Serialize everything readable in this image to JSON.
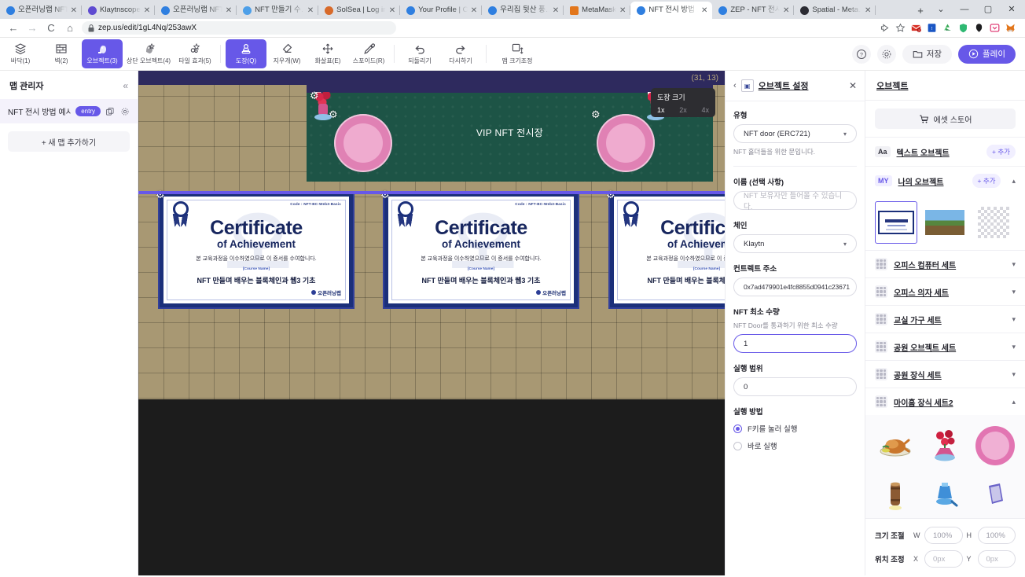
{
  "browser": {
    "tabs": [
      {
        "title": "오픈러닝랩 NFT",
        "favicon": "blue-circle",
        "active": false
      },
      {
        "title": "Klaytnscope",
        "favicon": "klaytn",
        "active": false
      },
      {
        "title": "오픈러닝랩 NFT",
        "favicon": "blue-circle",
        "active": false
      },
      {
        "title": "NFT 만들기 수…",
        "favicon": "paper-plane",
        "active": false
      },
      {
        "title": "SolSea | Log in",
        "favicon": "solsea",
        "active": false
      },
      {
        "title": "Your Profile | O…",
        "favicon": "blue-circle",
        "active": false
      },
      {
        "title": "우리집 뒷산 풍…",
        "favicon": "blue-circle",
        "active": false
      },
      {
        "title": "MetaMask",
        "favicon": "metamask",
        "active": false
      },
      {
        "title": "NFT 전시 방법 …",
        "favicon": "zep",
        "active": true
      },
      {
        "title": "ZEP - NFT 전시…",
        "favicon": "zep",
        "active": false
      },
      {
        "title": "Spatial - Meta…",
        "favicon": "spatial",
        "active": false
      }
    ],
    "new_tab_label": "+",
    "window_controls": [
      "⌄",
      "—",
      "▢",
      "✕"
    ],
    "nav": {
      "back": "←",
      "forward": "→",
      "reload": "C",
      "home": "⌂"
    },
    "url": "zep.us/edit/1gL4Nq/253awX",
    "lock_icon": "lock-icon",
    "actions": [
      "share-icon",
      "bookmark-star-icon"
    ],
    "extensions": [
      "gmail-icon",
      "translate-icon",
      "recycle-icon",
      "shield-icon",
      "ghost-icon",
      "pocket-icon",
      "metamask-icon"
    ]
  },
  "toolbar": {
    "tools": [
      {
        "label": "바닥(1)",
        "icon": "layers-icon",
        "active": false
      },
      {
        "label": "벽(2)",
        "icon": "wall-icon",
        "active": false
      },
      {
        "label": "오브젝트(3)",
        "icon": "object-icon",
        "active": true
      },
      {
        "label": "상단 오브젝트(4)",
        "icon": "top-object-icon",
        "active": false
      },
      {
        "label": "타일 효과(5)",
        "icon": "tile-effect-icon",
        "active": false
      }
    ],
    "tools2": [
      {
        "label": "도장(Q)",
        "icon": "stamp-icon",
        "active": true
      },
      {
        "label": "지우개(W)",
        "icon": "eraser-icon",
        "active": false
      },
      {
        "label": "화살표(E)",
        "icon": "move-icon",
        "active": false
      },
      {
        "label": "스포이드(R)",
        "icon": "eyedropper-icon",
        "active": false
      }
    ],
    "history": [
      {
        "label": "되돌리기",
        "icon": "undo-icon"
      },
      {
        "label": "다시하기",
        "icon": "redo-icon"
      }
    ],
    "resize": {
      "label": "맵 크기조정",
      "icon": "resize-icon"
    },
    "help_icon": "question-icon",
    "settings_icon": "gear-icon",
    "save_label": "저장",
    "save_icon": "folder-icon",
    "play_label": "플레이",
    "play_icon": "play-icon"
  },
  "left_panel": {
    "title": "맵 관리자",
    "collapse_icon": "chevron-double-left-icon",
    "map": {
      "name": "NFT 전시 방법 예시",
      "badge": "entry",
      "copy_icon": "copy-icon",
      "gear_icon": "gear-icon"
    },
    "add_map_label": "+ 새 맵 추가하기"
  },
  "canvas": {
    "coordinate": "(31, 13)",
    "stage_label": "VIP NFT 전시장",
    "stamp_popup": {
      "title": "도장 크기",
      "options": [
        "1x",
        "2x",
        "4x"
      ],
      "selected": "1x"
    },
    "certificate": {
      "code": "Code : NFT-BC-Web3-Basic",
      "title1": "Certificate",
      "title2": "of Achievement",
      "body": "본 교육과정을 이수하였으므로 이 증서를 수여합니다.",
      "course_label": "[Course Name]",
      "course_name": "NFT 만들며 배우는 블록체인과 웹3 기초",
      "logo": "오픈러닝랩",
      "watermark": "오"
    }
  },
  "settings_panel": {
    "back_icon": "chevron-left-icon",
    "thumb_icon": "object-thumbnail-icon",
    "title": "오브젝트 설정",
    "close_icon": "close-icon",
    "type_label": "유형",
    "type_value": "NFT door (ERC721)",
    "type_hint": "NFT 홀더들을 위한 문입니다.",
    "name_label": "이름 (선택 사항)",
    "name_placeholder": "NFT 보유자만 들어올 수 있습니다.",
    "chain_label": "체인",
    "chain_value": "Klaytn",
    "contract_label": "컨트렉트 주소",
    "contract_value": "0x7ad479901e4fc8855d0941c23671",
    "min_label": "NFT 최소 수량",
    "min_hint": "NFT Door를 통과하기 위한 최소 수량",
    "min_value": "1",
    "range_label": "실행 범위",
    "range_value": "0",
    "exec_label": "실행 방법",
    "exec_options": [
      {
        "label": "F키를 눌러 실행",
        "selected": true
      },
      {
        "label": "바로 실행",
        "selected": false
      }
    ]
  },
  "objects_panel": {
    "title": "오브젝트",
    "asset_store": {
      "label": "에셋 스토어",
      "icon": "cart-icon"
    },
    "text_object": {
      "tag": "Aa",
      "label": "텍스트 오브젝트",
      "add": "+ 추가"
    },
    "my_object": {
      "tag": "MY",
      "label": "나의 오브젝트",
      "add": "+ 추가",
      "chevron": "⌃"
    },
    "my_items": [
      {
        "name": "certificate-thumbnail",
        "selected": true
      },
      {
        "name": "landscape-photo-thumbnail",
        "selected": false
      },
      {
        "name": "transparent-checker-thumbnail",
        "selected": false
      }
    ],
    "categories": [
      {
        "label": "오피스 컴퓨터 세트",
        "expanded": false
      },
      {
        "label": "오피스 의자 세트",
        "expanded": false
      },
      {
        "label": "교실 가구 세트",
        "expanded": false
      },
      {
        "label": "공원 오브젝트 세트",
        "expanded": false
      },
      {
        "label": "공원 장식 세트",
        "expanded": false
      },
      {
        "label": "마이홈 장식 세트2",
        "expanded": true
      }
    ],
    "tiles": [
      "roast-chicken",
      "flower-vase",
      "pink-round-rug",
      "wooden-barrel",
      "blue-lamp",
      "purple-book"
    ],
    "size_label": "크기 조절",
    "size_w_key": "W",
    "size_w_value": "100%",
    "size_h_key": "H",
    "size_h_value": "100%",
    "pos_label": "위치 조정",
    "pos_x_key": "X",
    "pos_x_value": "0px",
    "pos_y_key": "Y",
    "pos_y_value": "0px"
  },
  "colors": {
    "accent": "#6758e8",
    "stage": "#1d5446",
    "ground": "#a89873",
    "carpet": "#2e2a5e"
  }
}
